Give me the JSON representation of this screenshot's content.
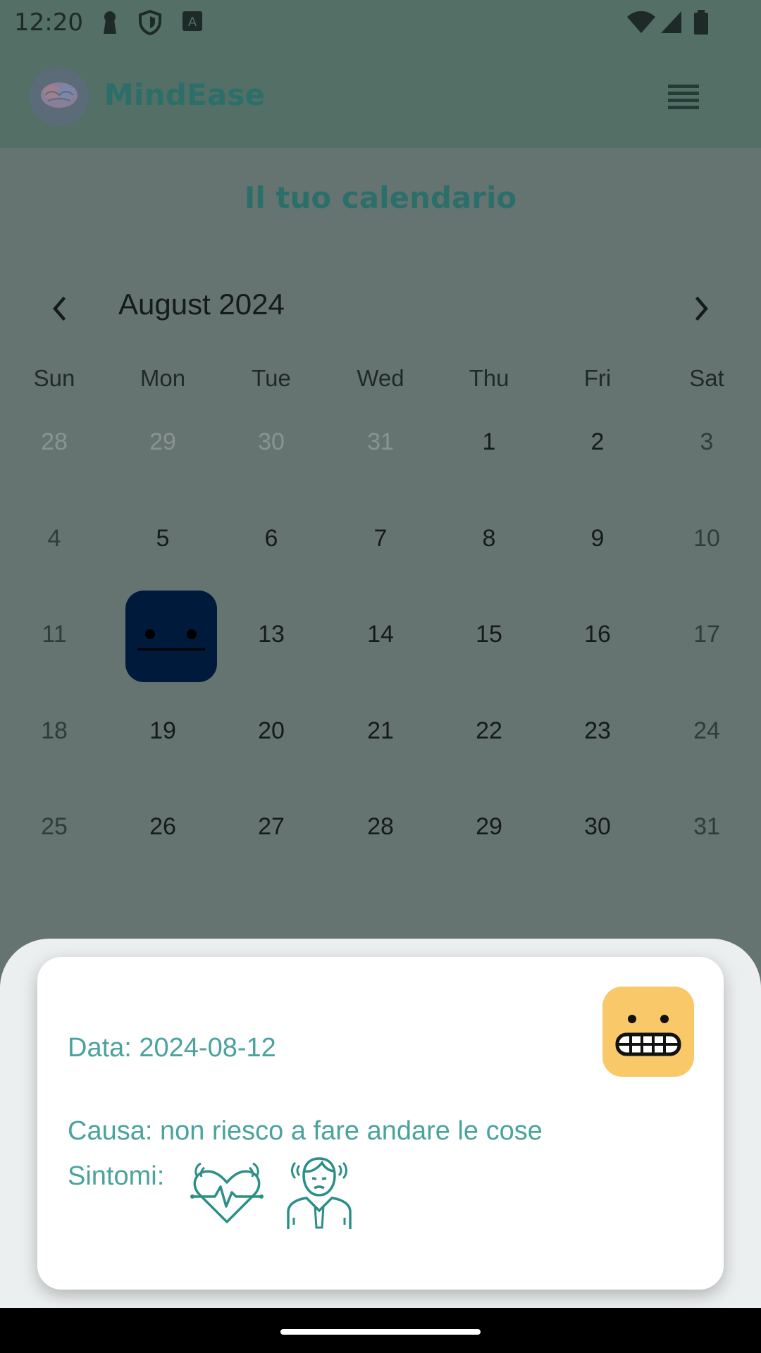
{
  "status_bar": {
    "time": "12:20"
  },
  "app_bar": {
    "title": "MindEase"
  },
  "page": {
    "title": "Il tuo calendario"
  },
  "calendar": {
    "month_label": "August 2024",
    "weekdays": [
      "Sun",
      "Mon",
      "Tue",
      "Wed",
      "Thu",
      "Fri",
      "Sat"
    ],
    "weeks": [
      [
        "28",
        "29",
        "30",
        "31",
        "1",
        "2",
        "3"
      ],
      [
        "4",
        "5",
        "6",
        "7",
        "8",
        "9",
        "10"
      ],
      [
        "11",
        "",
        "13",
        "14",
        "15",
        "16",
        "17"
      ],
      [
        "18",
        "19",
        "20",
        "21",
        "22",
        "23",
        "24"
      ],
      [
        "25",
        "26",
        "27",
        "28",
        "29",
        "30",
        "31"
      ]
    ],
    "selected_mood_icon": "neutral-face-icon"
  },
  "detail_card": {
    "date_text": "Data: 2024-08-12",
    "cause_text": "Causa: non riesco a fare andare le cose",
    "symptoms_label": "Sintomi:",
    "mood_icon": "grimacing-face-icon",
    "symptom_icons": [
      "heart-palpitations-icon",
      "trembling-person-icon"
    ]
  },
  "colors": {
    "accent": "#4aa39d",
    "mood_yellow": "#f9c868",
    "selected_dark": "#001a3b",
    "appbar": "#536f66"
  }
}
